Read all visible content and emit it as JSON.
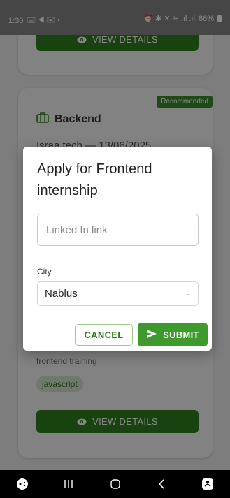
{
  "status_bar": {
    "time": "1:30",
    "left_icons": "🖃 ◀ ✉ •",
    "right_icons": "⏰ ✱ ✕ ≋ .ıl .ıl",
    "battery": "86%"
  },
  "cards": {
    "view_details_label": "VIEW DETAILS",
    "badge": "Recommended",
    "job_title": "Backend",
    "job_subtitle": "Israa tech — 13/06/2025",
    "job_description": "frontend training",
    "tag": "javascript"
  },
  "dialog": {
    "title": "Apply for Frontend internship",
    "linkedin_placeholder": "Linked In link",
    "linkedin_value": "",
    "city_label": "City",
    "city_selected": "Nablus",
    "cancel_label": "CANCEL",
    "submit_label": "SUBMIT"
  },
  "colors": {
    "primary": "#2f7d1f",
    "submit": "#3f9a2e",
    "badge": "#3c8a2a",
    "scrim": "rgba(0,0,0,0.47)"
  }
}
